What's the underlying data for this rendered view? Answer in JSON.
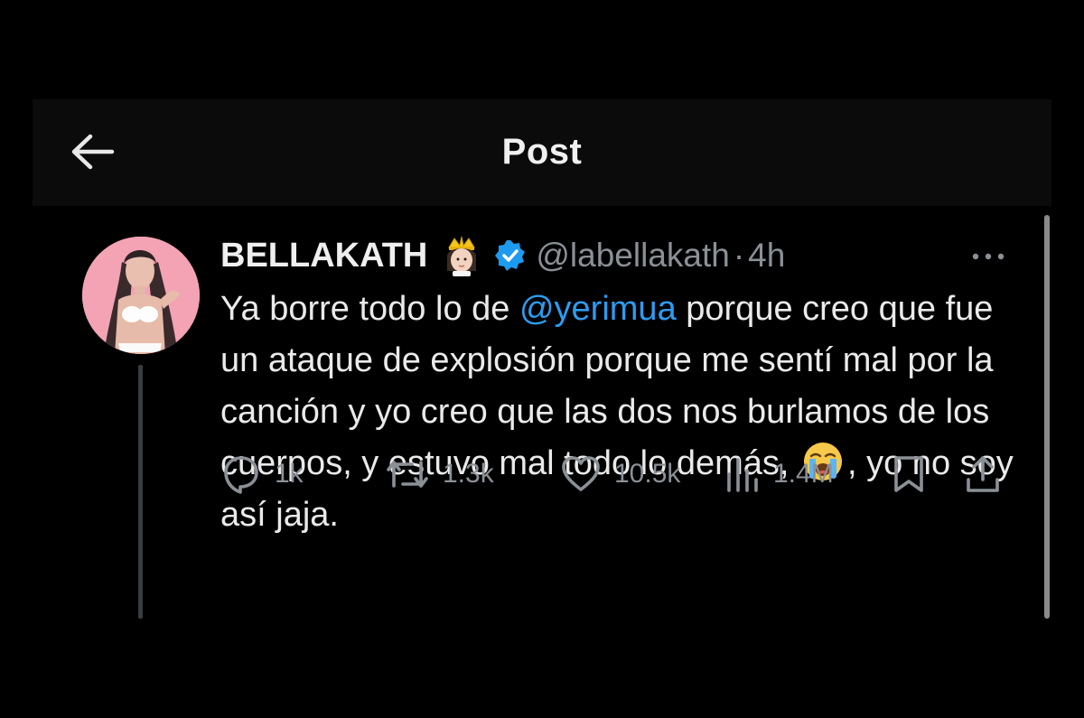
{
  "header": {
    "title": "Post"
  },
  "tweet": {
    "display_name": "BELLAKATH",
    "handle": "@labellakath",
    "separator": "·",
    "time": "4h",
    "text_before": "Ya borre todo lo de ",
    "mention": "@yerimua",
    "text_after": " porque creo que fue un ataque de explosión porque me sentí mal por la canción y yo creo que las dos nos burlamos de los cuerpos, y estuvo mal todo lo demás, ",
    "text_end": ", yo no soy así jaja."
  },
  "actions": {
    "replies": "1k",
    "reposts": "1.3k",
    "likes": "10.5k",
    "views": "1.4M"
  },
  "colors": {
    "background": "#000000",
    "header_bg": "#0b0b0b",
    "text": "#e7e9ea",
    "secondary": "#8b9096",
    "accent": "#1d9bf0",
    "avatar_bg": "#f3a3b4"
  },
  "icons": [
    "back-arrow-icon",
    "crown-emoji-icon",
    "verified-badge-icon",
    "more-icon",
    "crying-emoji-icon",
    "reply-icon",
    "repost-icon",
    "like-icon",
    "views-icon",
    "bookmark-icon",
    "share-icon"
  ]
}
